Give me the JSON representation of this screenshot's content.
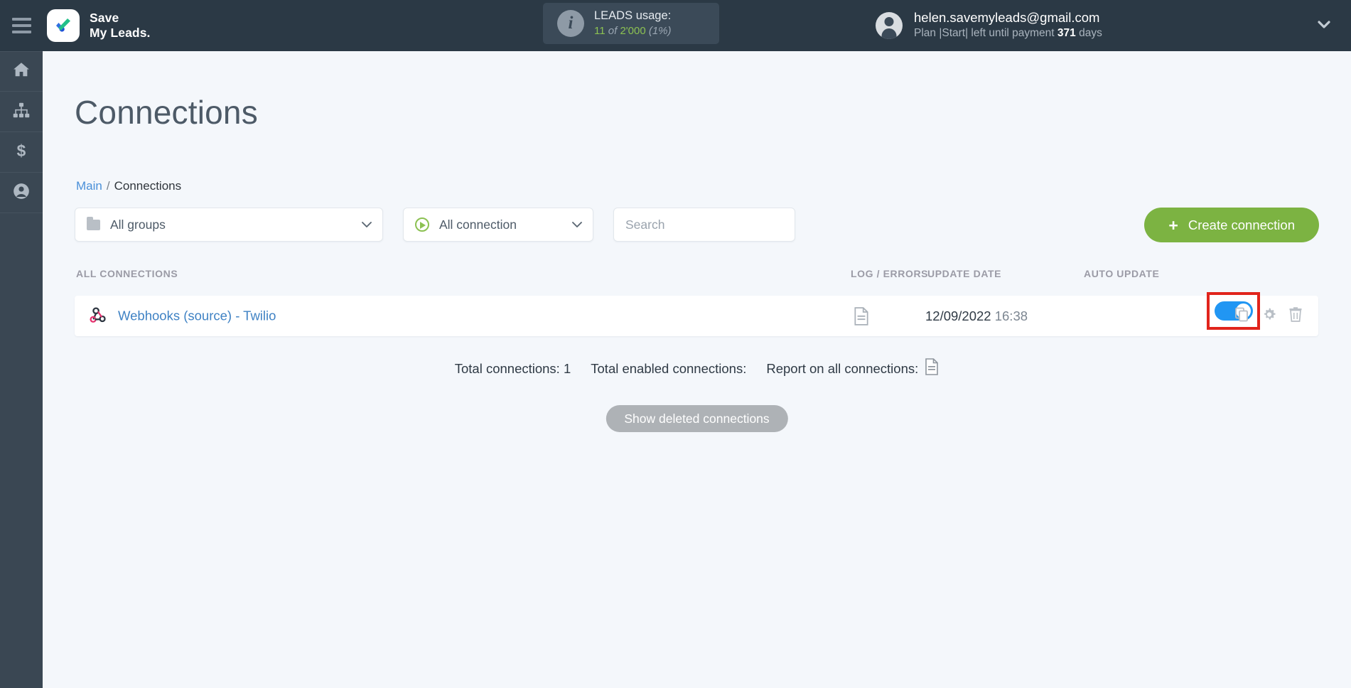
{
  "topbar": {
    "menu_icon": "hamburger-icon",
    "brand_line1": "Save",
    "brand_line2": "My Leads.",
    "logo_icon": "checkmark-logo-icon",
    "leads": {
      "info_icon": "info-icon",
      "title": "LEADS usage:",
      "used": "11",
      "of": "of",
      "total": "2'000",
      "percent": "(1%)"
    },
    "account": {
      "avatar_icon": "user-avatar-icon",
      "email": "helen.savemyleads@gmail.com",
      "plan_prefix": "Plan |Start| left until payment",
      "plan_days": "371",
      "plan_suffix": "days",
      "caret_icon": "chevron-down-icon"
    }
  },
  "sidebar": {
    "items": [
      {
        "name": "home",
        "icon": "home-icon"
      },
      {
        "name": "connections",
        "icon": "sitemap-icon"
      },
      {
        "name": "billing",
        "icon": "dollar-icon"
      },
      {
        "name": "account",
        "icon": "user-icon"
      }
    ]
  },
  "page": {
    "title": "Connections",
    "breadcrumb": {
      "root": "Main",
      "separator": "/",
      "current": "Connections"
    }
  },
  "filters": {
    "groups": {
      "label": "All groups",
      "icon": "folder-icon",
      "chevron": "chevron-down-icon"
    },
    "connection": {
      "label": "All connection",
      "icon": "play-circle-icon",
      "chevron": "chevron-down-icon"
    },
    "search": {
      "placeholder": "Search",
      "value": "",
      "icon": "search-input"
    },
    "create_button": {
      "label": "Create connection",
      "plus": "+"
    }
  },
  "table": {
    "headers": {
      "all_connections": "ALL CONNECTIONS",
      "log_errors": "LOG / ERRORS",
      "update_date": "UPDATE DATE",
      "auto_update": "AUTO UPDATE"
    },
    "rows": [
      {
        "icon": "webhook-icon",
        "name": "Webhooks (source) - Twilio",
        "log_icon": "document-icon",
        "date": "12/09/2022",
        "time": "16:38",
        "auto_update_enabled": true,
        "actions": [
          "copy-icon",
          "gear-icon",
          "trash-icon"
        ]
      }
    ]
  },
  "footer": {
    "total_connections_label": "Total connections:",
    "total_connections_value": "1",
    "total_enabled_label": "Total enabled connections:",
    "total_enabled_value": "",
    "report_label": "Report on all connections:",
    "report_icon": "document-icon",
    "show_deleted_label": "Show deleted connections"
  },
  "colors": {
    "topbar_bg": "#2b3945",
    "rail_bg": "#3a4753",
    "page_bg": "#f4f7fb",
    "accent_green": "#7cb342",
    "link_blue": "#3f82c4",
    "toggle_on": "#2196f3",
    "highlight_red": "#e1241c"
  }
}
